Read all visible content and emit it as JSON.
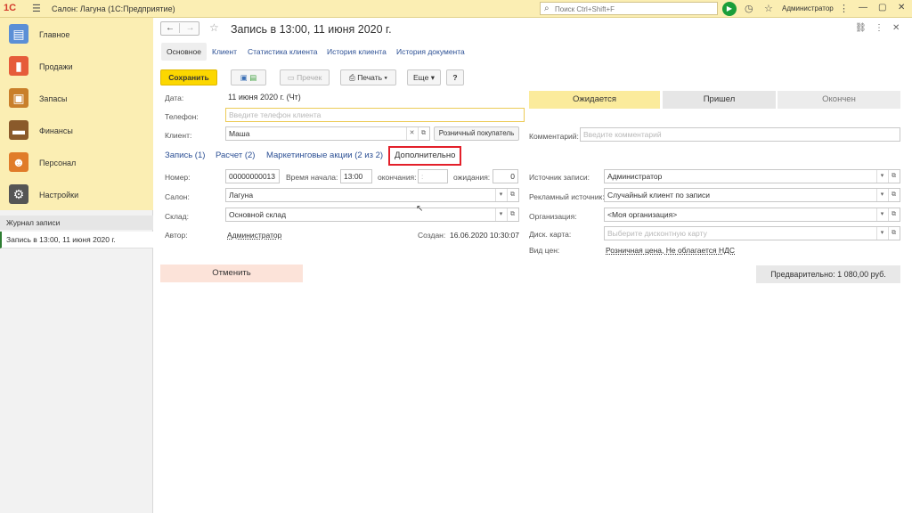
{
  "titlebar": {
    "logo": "1С",
    "app_title": "Салон: Лагуна  (1С:Предприятие)",
    "search_placeholder": "Поиск Ctrl+Shift+F",
    "user": "Администратор",
    "icons": [
      "menu-icon",
      "bell-icon",
      "search-icon",
      "play-icon",
      "history-icon",
      "star-icon",
      "minimize-icon",
      "maximize-icon",
      "close-icon"
    ]
  },
  "sidebar": {
    "sections": [
      {
        "label": "Главное",
        "icon": "home-icon",
        "color": "#5b8fd6"
      },
      {
        "label": "Продажи",
        "icon": "chart-icon",
        "color": "#e65c3a"
      },
      {
        "label": "Запасы",
        "icon": "box-icon",
        "color": "#c97f2a"
      },
      {
        "label": "Финансы",
        "icon": "wallet-icon",
        "color": "#8a5a2b"
      },
      {
        "label": "Персонал",
        "icon": "people-icon",
        "color": "#e07c2a"
      },
      {
        "label": "Настройки",
        "icon": "gear-icon",
        "color": "#555555"
      }
    ],
    "journal_title": "Журнал записи",
    "journal_item": "Запись в 13:00, 11 июня 2020 г."
  },
  "doc": {
    "title": "Запись в 13:00, 11 июня 2020 г.",
    "tabs": [
      "Основное",
      "Клиент",
      "Статистика клиента",
      "История клиента",
      "История документа"
    ],
    "toolbar": {
      "save": "Сохранить",
      "receipt": "Пречек",
      "print": "Печать",
      "more": "Еще",
      "help": "?"
    },
    "fields": {
      "date_label": "Дата:",
      "date_value": "11 июня 2020 г. (Чт)",
      "phone_label": "Телефон:",
      "phone_placeholder": "Введите телефон клиента",
      "client_label": "Клиент:",
      "client_value": "Маша",
      "retail_buyer": "Розничный покупатель",
      "comment_label": "Комментарий:",
      "comment_placeholder": "Введите комментарий"
    },
    "statuses": [
      {
        "label": "Ожидается",
        "bg": "#fbeb9c"
      },
      {
        "label": "Пришел",
        "bg": "#e6e6e6"
      },
      {
        "label": "Окончен",
        "bg": "#ececec"
      }
    ],
    "subtabs": [
      "Запись (1)",
      "Расчет (2)",
      "Маркетинговые акции (2 из 2)",
      "Дополнительно"
    ],
    "details": {
      "number_label": "Номер:",
      "number_value": "00000000013",
      "start_label": "Время начала:",
      "start_value": "13:00",
      "end_label": "окончания:",
      "end_value": ":",
      "wait_label": "ожидания:",
      "wait_value": "0",
      "salon_label": "Салон:",
      "salon_value": "Лагуна",
      "warehouse_label": "Склад:",
      "warehouse_value": "Основной склад",
      "author_label": "Автор:",
      "author_value": "Администратор",
      "created_label": "Создан:",
      "created_value": "16.06.2020 10:30:07",
      "source_label": "Источник записи:",
      "source_value": "Администратор",
      "ad_label": "Рекламный источник:",
      "ad_value": "Случайный клиент по записи",
      "org_label": "Организация:",
      "org_value": "<Моя организация>",
      "card_label": "Диск. карта:",
      "card_placeholder": "Выберите дисконтную карту",
      "price_label": "Вид цен:",
      "price_value": "Розничная цена, Не облагается НДС"
    },
    "cancel": "Отменить",
    "preliminary": "Предварительно: 1 080,00 руб."
  }
}
